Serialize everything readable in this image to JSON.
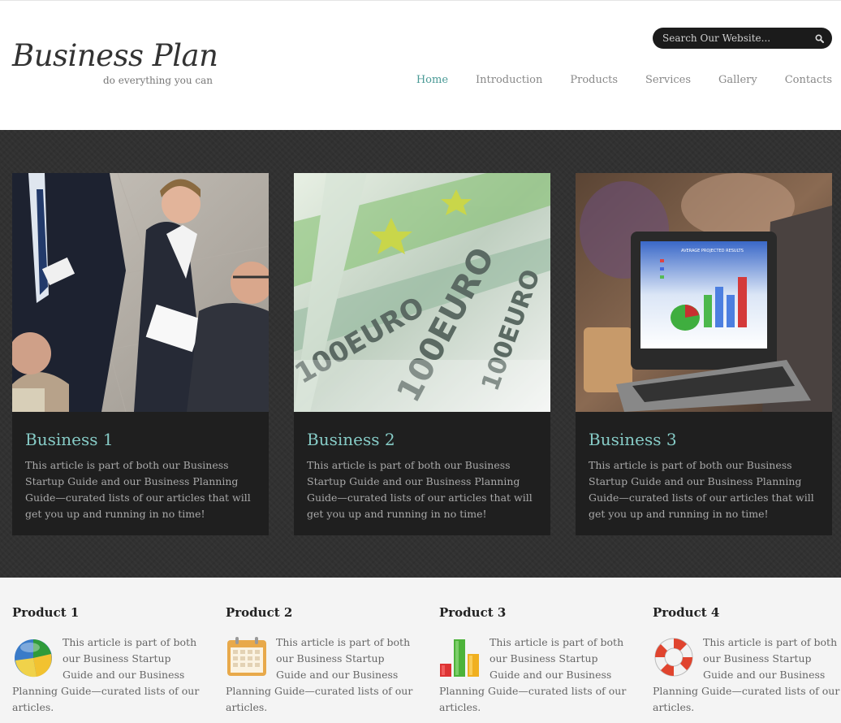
{
  "header": {
    "logo_title": "Business Plan",
    "logo_tagline": "do everything you can",
    "search_placeholder": "Search Our Website...",
    "nav": [
      {
        "label": "Home",
        "active": true
      },
      {
        "label": "Introduction"
      },
      {
        "label": "Products"
      },
      {
        "label": "Services"
      },
      {
        "label": "Gallery"
      },
      {
        "label": "Contacts"
      }
    ]
  },
  "features": [
    {
      "title": "Business 1",
      "text": "This article is part of both our Business Startup Guide and our Business Planning Guide—curated lists of our articles that will get you up and running in no time!",
      "image": "business-meeting-photo"
    },
    {
      "title": "Business 2",
      "text": "This article is part of both our Business Startup Guide and our Business Planning Guide—curated lists of our articles that will get you up and running in no time!",
      "image": "euro-banknotes-photo"
    },
    {
      "title": "Business 3",
      "text": "This article is part of both our Business Startup Guide and our Business Planning Guide—curated lists of our articles that will get you up and running in no time!",
      "image": "laptop-chart-photo"
    }
  ],
  "products": [
    {
      "title": "Product 1",
      "icon": "pie-chart-icon",
      "text": "This article is part of both our Business Startup Guide and our Business Planning Guide—curated lists of our articles."
    },
    {
      "title": "Product 2",
      "icon": "calendar-icon",
      "text": "This article is part of both our Business Startup Guide and our Business Planning Guide—curated lists of our articles."
    },
    {
      "title": "Product 3",
      "icon": "bar-chart-icon",
      "text": "This article is part of both our Business Startup Guide and our Business Planning Guide—curated lists of our articles."
    },
    {
      "title": "Product 4",
      "icon": "lifebuoy-icon",
      "text": "This article is part of both our Business Startup Guide and our Business Planning Guide—curated lists of our articles."
    }
  ],
  "colors": {
    "accent": "#4a9a96",
    "card_title": "#86cbc6",
    "band_bg": "#313131",
    "card_bg": "#1f1f1f"
  }
}
